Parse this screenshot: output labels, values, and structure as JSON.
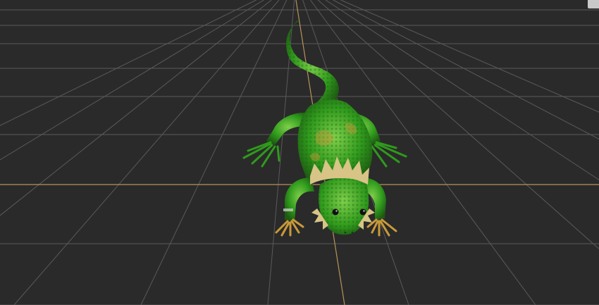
{
  "viewport": {
    "view": "perspective",
    "background_color": "#2a2a2a",
    "grid_color": "#5a5a5a",
    "axis_color": "#b8925a",
    "grid_visible": true
  },
  "scene": {
    "object": "lizard-model",
    "skin_colors": {
      "primary": "#2f9a1c",
      "dark": "#1d5a12",
      "highlight": "#7fd04a",
      "accent": "#c99a3a",
      "crest": "#d8c486"
    }
  },
  "widgets": {
    "viewcube_icon": "corner-square"
  }
}
